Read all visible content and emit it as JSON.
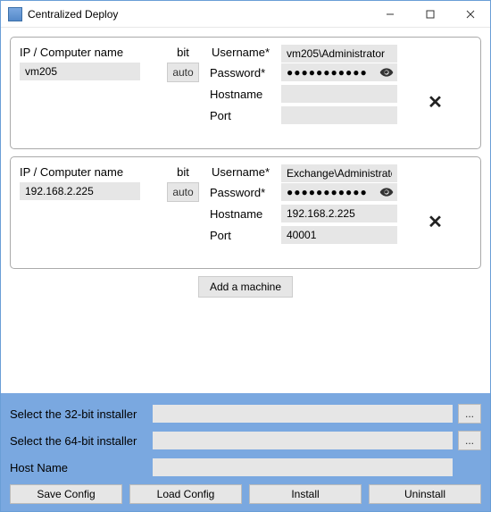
{
  "window": {
    "title": "Centralized Deploy"
  },
  "headers": {
    "ip": "IP / Computer name",
    "bit": "bit",
    "username": "Username*",
    "password": "Password*",
    "hostname": "Hostname",
    "port": "Port"
  },
  "machines": [
    {
      "ip": "vm205",
      "bit": "auto",
      "username": "vm205\\Administrator",
      "password": "●●●●●●●●●●●",
      "hostname": "",
      "port": ""
    },
    {
      "ip": "192.168.2.225",
      "bit": "auto",
      "username": "Exchange\\Administrator",
      "password": "●●●●●●●●●●●",
      "hostname": "192.168.2.225",
      "port": "40001"
    }
  ],
  "add_label": "Add a machine",
  "bottom": {
    "installer32_label": "Select the 32-bit installer",
    "installer64_label": "Select the 64-bit installer",
    "hostname_label": "Host Name",
    "browse": "...",
    "installer32_value": "",
    "installer64_value": "",
    "hostname_value": ""
  },
  "buttons": {
    "save": "Save Config",
    "load": "Load Config",
    "install": "Install",
    "uninstall": "Uninstall"
  }
}
